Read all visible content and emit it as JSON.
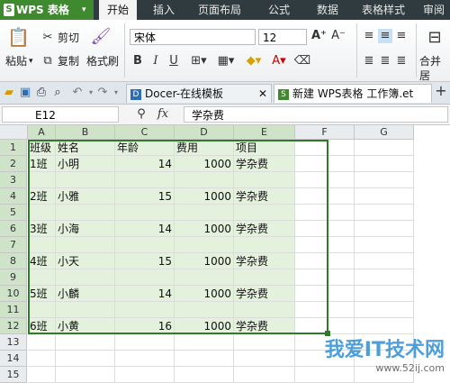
{
  "app": {
    "name": "WPS 表格",
    "logo_letter": "S",
    "caret": "▾"
  },
  "menu": [
    "开始",
    "插入",
    "页面布局",
    "公式",
    "数据",
    "表格样式",
    "审阅"
  ],
  "ribbon": {
    "cut": "剪切",
    "paste": "粘贴",
    "copy": "复制",
    "format_painter": "格式刷",
    "font": "宋体",
    "font_size": "12",
    "merge": "合并居",
    "bold": "B",
    "italic": "I",
    "underline": "U"
  },
  "tabs": [
    {
      "label": "Docer-在线模板"
    },
    {
      "label": "新建 WPS表格 工作簿.et"
    }
  ],
  "formula_bar": {
    "cell_ref": "E12",
    "fx": "fx",
    "content": "学杂费"
  },
  "columns": [
    "A",
    "B",
    "C",
    "D",
    "E",
    "F",
    "G"
  ],
  "rows": [
    "1",
    "2",
    "3",
    "4",
    "5",
    "6",
    "7",
    "8",
    "9",
    "10",
    "11",
    "12",
    "13",
    "14",
    "15"
  ],
  "table": {
    "headers": [
      "班级",
      "姓名",
      "年龄",
      "费用",
      "项目"
    ],
    "data": [
      [
        "1班",
        "小明",
        "14",
        "1000",
        "学杂费"
      ],
      [
        "",
        "",
        "",
        "",
        ""
      ],
      [
        "2班",
        "小雅",
        "15",
        "1000",
        "学杂费"
      ],
      [
        "",
        "",
        "",
        "",
        ""
      ],
      [
        "3班",
        "小海",
        "14",
        "1000",
        "学杂费"
      ],
      [
        "",
        "",
        "",
        "",
        ""
      ],
      [
        "4班",
        "小天",
        "15",
        "1000",
        "学杂费"
      ],
      [
        "",
        "",
        "",
        "",
        ""
      ],
      [
        "5班",
        "小麟",
        "14",
        "1000",
        "学杂费"
      ],
      [
        "",
        "",
        "",
        "",
        ""
      ],
      [
        "6班",
        "小黄",
        "16",
        "1000",
        "学杂费"
      ]
    ]
  },
  "watermark": {
    "main": "我爱IT技术网",
    "sub": "www.52ij.com"
  },
  "colors": {
    "accent": "#3f8a2f",
    "selection": "#2f7a2a",
    "selected_fill": "#e3f1dd"
  }
}
